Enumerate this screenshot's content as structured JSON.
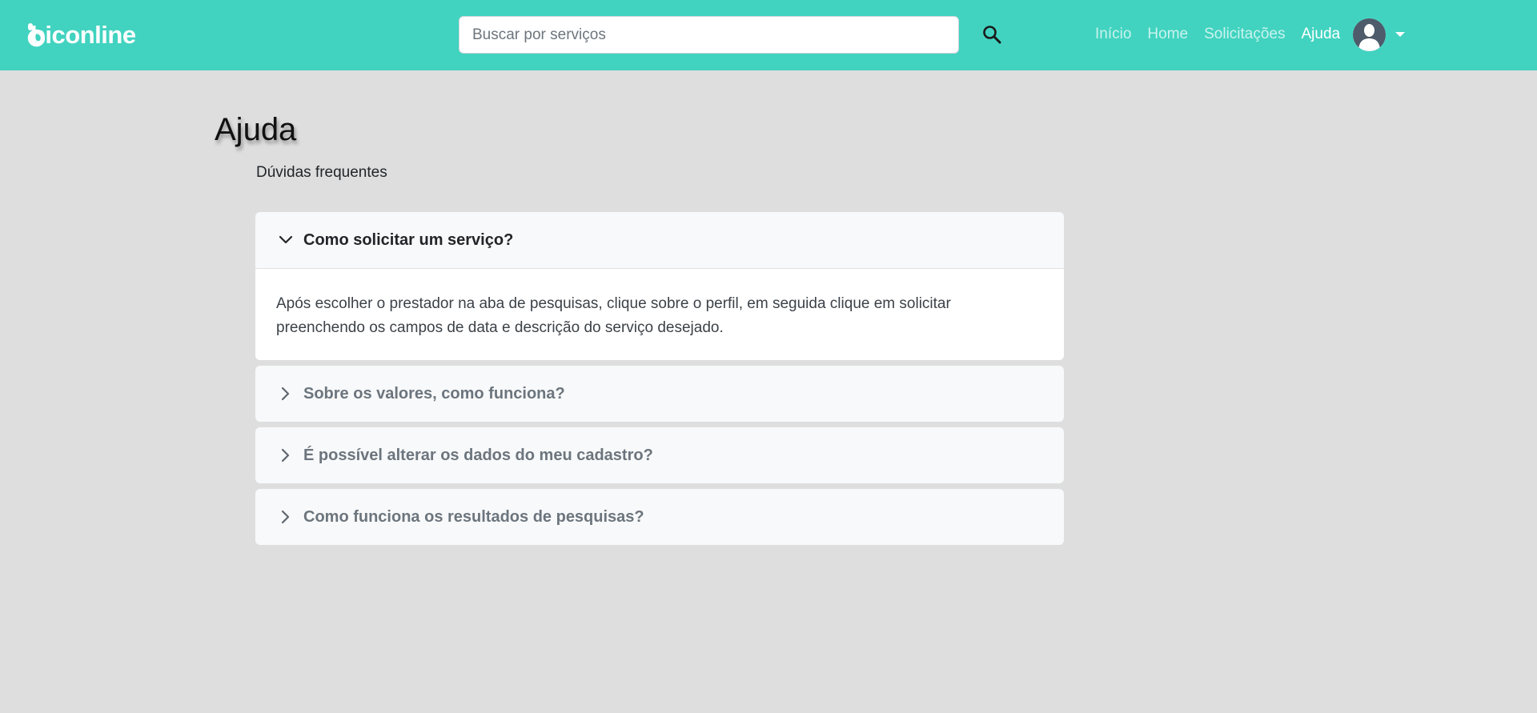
{
  "brand": {
    "name": "biconline",
    "accent": "#41d3c0",
    "background": "#dedede"
  },
  "search": {
    "placeholder": "Buscar por serviços",
    "value": "",
    "icon": "search-icon"
  },
  "nav": {
    "links": [
      {
        "label": "Início",
        "active": false
      },
      {
        "label": "Home",
        "active": false
      },
      {
        "label": "Solicitações",
        "active": false
      },
      {
        "label": "Ajuda",
        "active": true
      }
    ],
    "avatar_icon": "user-avatar-icon",
    "dropdown_icon": "caret-down-icon"
  },
  "page": {
    "title": "Ajuda",
    "subtitle": "Dúvidas frequentes"
  },
  "faq": [
    {
      "question": "Como solicitar um serviço?",
      "answer": "Após escolher o prestador na aba de pesquisas, clique sobre o perfil, em seguida clique em solicitar preenchendo os campos de data e descrição do serviço desejado.",
      "expanded": true
    },
    {
      "question": "Sobre os valores, como funciona?",
      "answer": "",
      "expanded": false
    },
    {
      "question": "É possível alterar os dados do meu cadastro?",
      "answer": "",
      "expanded": false
    },
    {
      "question": "Como funciona os resultados de pesquisas?",
      "answer": "",
      "expanded": false
    }
  ]
}
